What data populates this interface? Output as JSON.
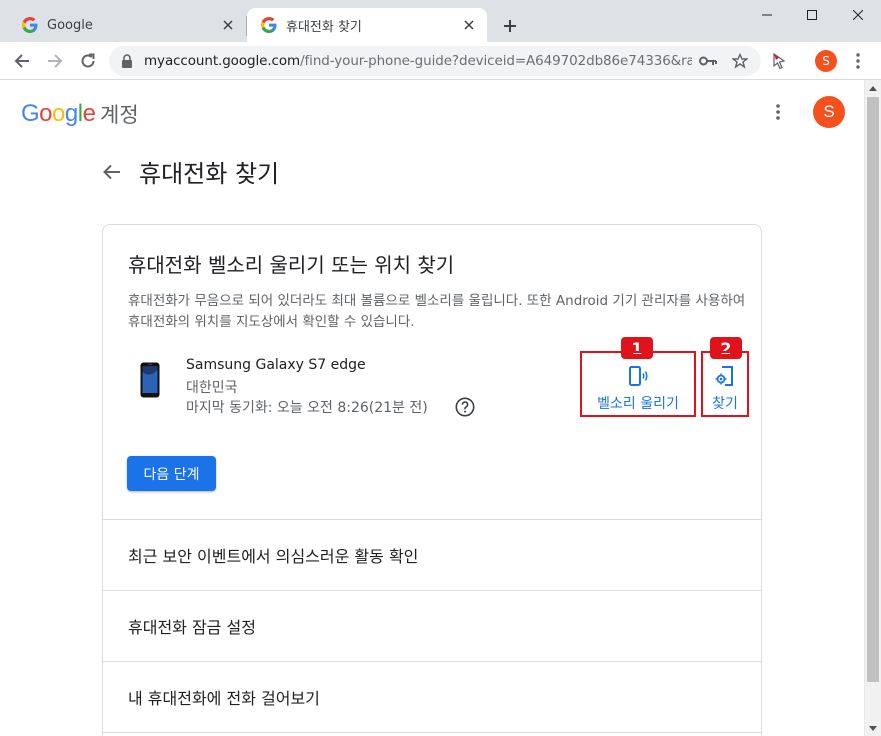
{
  "browser": {
    "tabs": [
      {
        "title": "Google",
        "active": false
      },
      {
        "title": "휴대전화 찾기",
        "active": true
      }
    ],
    "address": {
      "host": "myaccount.google.com",
      "path": "/find-your-phone-guide?deviceid=A649702db86e74336&rap..."
    },
    "profile_initial": "S"
  },
  "header": {
    "logo_letters": [
      "G",
      "o",
      "o",
      "g",
      "l",
      "e"
    ],
    "logo_colors": [
      "#4285F4",
      "#EA4335",
      "#FBBC05",
      "#4285F4",
      "#34A853",
      "#EA4335"
    ],
    "account_label": "계정",
    "avatar_initial": "S"
  },
  "page": {
    "title": "휴대전화 찾기"
  },
  "card": {
    "title": "휴대전화 벨소리 울리기 또는 위치 찾기",
    "description": "휴대전화가 무음으로 되어 있더라도 최대 볼륨으로 벨소리를 울립니다. 또한 Android 기기 관리자를 사용하여 휴대전화의 위치를 지도상에서 확인할 수 있습니다.",
    "device": {
      "name": "Samsung Galaxy S7 edge",
      "country": "대한민국",
      "last_sync": "마지막 동기화: 오늘 오전 8:26(21분 전)"
    },
    "actions": {
      "ring_label": "벨소리 울리기",
      "find_label": "찾기"
    },
    "markers": [
      "1",
      "2"
    ],
    "next_button": "다음 단계"
  },
  "rows": [
    "최근 보안 이벤트에서 의심스러운 활동 확인",
    "휴대전화 잠금 설정",
    "내 휴대전화에 전화 걸어보기"
  ],
  "colors": {
    "accent": "#1a73e8",
    "annotation_red": "#e0131b",
    "avatar_orange": "#f4511e"
  }
}
